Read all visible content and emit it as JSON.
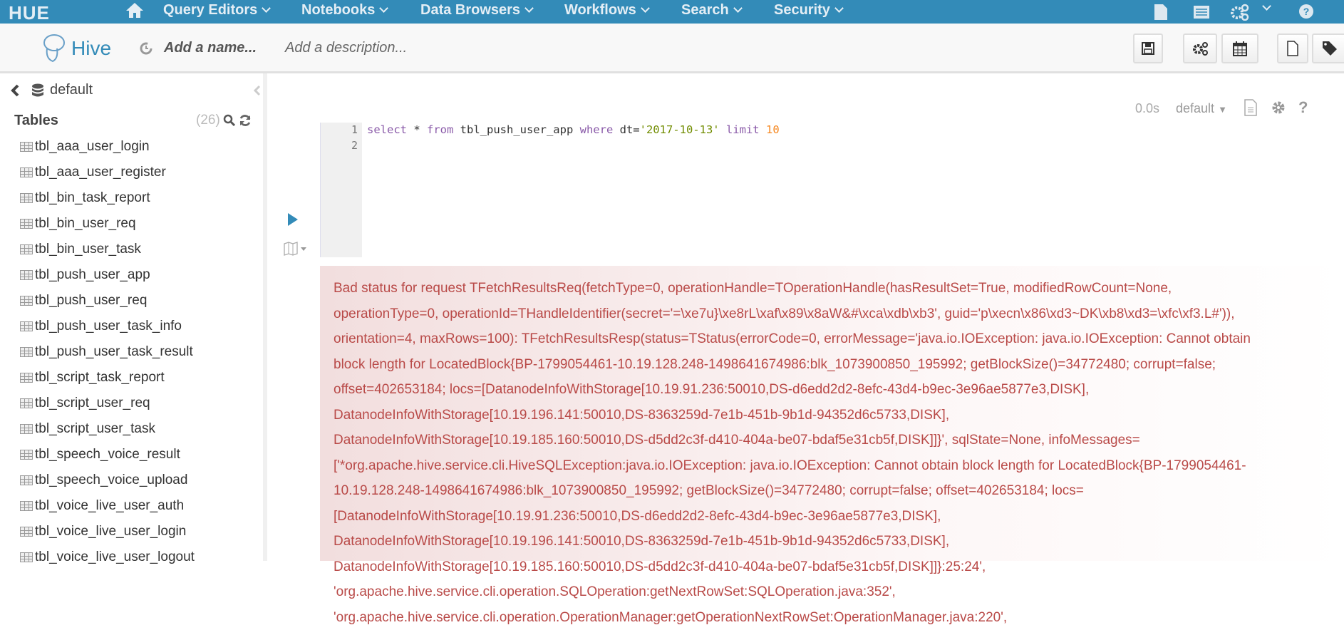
{
  "topnav": {
    "logo": "HUE",
    "items": [
      {
        "label": "Query Editors"
      },
      {
        "label": "Notebooks"
      },
      {
        "label": "Data Browsers"
      },
      {
        "label": "Workflows"
      },
      {
        "label": "Search"
      },
      {
        "label": "Security"
      }
    ],
    "icons": [
      "home-icon",
      "document-icon",
      "table-list-icon",
      "gears-icon",
      "help-icon"
    ],
    "color": "#338bb8"
  },
  "editor_header": {
    "app": "Hive",
    "name_placeholder": "Add a name...",
    "description_placeholder": "Add a description...",
    "buttons": [
      "save-icon",
      "gears-icon",
      "calendar-icon",
      "new-document-icon",
      "tag-icon"
    ]
  },
  "sidebar": {
    "database": "default",
    "tables_label": "Tables",
    "count": "(26)",
    "tables": [
      "tbl_aaa_user_login",
      "tbl_aaa_user_register",
      "tbl_bin_task_report",
      "tbl_bin_user_req",
      "tbl_bin_user_task",
      "tbl_push_user_app",
      "tbl_push_user_req",
      "tbl_push_user_task_info",
      "tbl_push_user_task_result",
      "tbl_script_task_report",
      "tbl_script_user_req",
      "tbl_script_user_task",
      "tbl_speech_voice_result",
      "tbl_speech_voice_upload",
      "tbl_voice_live_user_auth",
      "tbl_voice_live_user_login",
      "tbl_voice_live_user_logout"
    ]
  },
  "snippet": {
    "time": "0.0s",
    "database": "default",
    "code": {
      "kw1": "select",
      "p1": " * ",
      "kw2": "from",
      "p2": " tbl_push_user_app ",
      "kw3": "where",
      "p3": " dt=",
      "str": "'2017-10-13'",
      "p4": " ",
      "kw4": "limit",
      "p5": " ",
      "num": "10"
    },
    "line_numbers": [
      "1",
      "2"
    ]
  },
  "error": {
    "lines": [
      "Bad status for request TFetchResultsReq(fetchType=0, operationHandle=TOperationHandle(hasResultSet=True, modifiedRowCount=None,",
      "operationType=0, operationId=THandleIdentifier(secret='=\\xe7u}\\xe8rL\\xaf\\x89\\x8aW&#\\xca\\xdb\\xb3', guid='p\\xecn\\x86\\xd3~DK\\xb8\\xd3=\\xfc\\xf3.L#')),",
      "orientation=4, maxRows=100): TFetchResultsResp(status=TStatus(errorCode=0, errorMessage='java.io.IOException: java.io.IOException: Cannot obtain",
      "block length for LocatedBlock{BP-1799054461-10.19.128.248-1498641674986:blk_1073900850_195992; getBlockSize()=34772480; corrupt=false;",
      "offset=402653184; locs=[DatanodeInfoWithStorage[10.19.91.236:50010,DS-d6edd2d2-8efc-43d4-b9ec-3e96ae5877e3,DISK],",
      "DatanodeInfoWithStorage[10.19.196.141:50010,DS-8363259d-7e1b-451b-9b1d-94352d6c5733,DISK],",
      "DatanodeInfoWithStorage[10.19.185.160:50010,DS-d5dd2c3f-d410-404a-be07-bdaf5e31cb5f,DISK]]}', sqlState=None, infoMessages=",
      "['*org.apache.hive.service.cli.HiveSQLException:java.io.IOException: java.io.IOException: Cannot obtain block length for LocatedBlock{BP-1799054461-",
      "10.19.128.248-1498641674986:blk_1073900850_195992; getBlockSize()=34772480; corrupt=false; offset=402653184; locs=",
      "[DatanodeInfoWithStorage[10.19.91.236:50010,DS-d6edd2d2-8efc-43d4-b9ec-3e96ae5877e3,DISK],",
      "DatanodeInfoWithStorage[10.19.196.141:50010,DS-8363259d-7e1b-451b-9b1d-94352d6c5733,DISK],",
      "DatanodeInfoWithStorage[10.19.185.160:50010,DS-d5dd2c3f-d410-404a-be07-bdaf5e31cb5f,DISK]]}:25:24',",
      "'org.apache.hive.service.cli.operation.SQLOperation:getNextRowSet:SQLOperation.java:352',",
      "'org.apache.hive.service.cli.operation.OperationManager:getOperationNextRowSet:OperationManager.java:220',"
    ],
    "color": "#b94a48"
  }
}
